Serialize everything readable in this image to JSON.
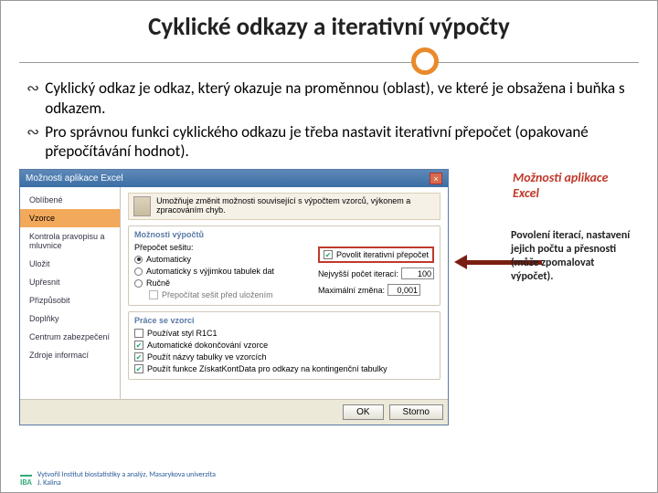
{
  "title": "Cyklické odkazy a iterativní výpočty",
  "bullets": [
    "Cyklický odkaz je odkaz, který okazuje na proměnnou (oblast), ve které je obsažena i buňka s odkazem.",
    "Pro správnou funkci cyklického odkazu je třeba nastavit iterativní přepočet (opakované přepočítávání hodnot)."
  ],
  "dialog": {
    "title": "Možnosti aplikace Excel",
    "nav": {
      "i0": "Oblíbené",
      "i1": "Vzorce",
      "i2": "Kontrola pravopisu a mluvnice",
      "i3": "Uložit",
      "i4": "Upřesnit",
      "i5": "Přizpůsobit",
      "i6": "Doplňky",
      "i7": "Centrum zabezpečení",
      "i8": "Zdroje informací"
    },
    "info": "Umožňuje změnit možnosti související s výpočtem vzorců, výkonem a zpracováním chyb.",
    "grp1": {
      "title": "Možnosti výpočtů",
      "label": "Přepočet sešitu:",
      "r0": "Automaticky",
      "r1": "Automaticky s výjimkou tabulek dat",
      "r2": "Ručně",
      "r2sub": "Přepočítat sešit před uložením",
      "iter": "Povolit iterativní přepočet",
      "max_iter_l": "Nejvyšší počet iterací:",
      "max_iter_v": "100",
      "max_chg_l": "Maximální změna:",
      "max_chg_v": "0,001"
    },
    "grp2": {
      "title": "Práce se vzorci",
      "c0": "Používat styl R1C1",
      "c1": "Automatické dokončování vzorce",
      "c2": "Použít názvy tabulky ve vzorcích",
      "c3": "Použít funkce ZískatKontData pro odkazy na kontingenční tabulky"
    },
    "ok": "OK",
    "cancel": "Storno"
  },
  "callout1": "Možnosti aplikace Excel",
  "callout2": "Povolení iterací, nastavení jejich počtu a přesnosti (může zpomalovat výpočet).",
  "footer": {
    "logo": "IBA",
    "l1": "Vytvořil Institut biostatistiky a analýz, Masarykova univerzita",
    "l2": "J. Kalina"
  }
}
